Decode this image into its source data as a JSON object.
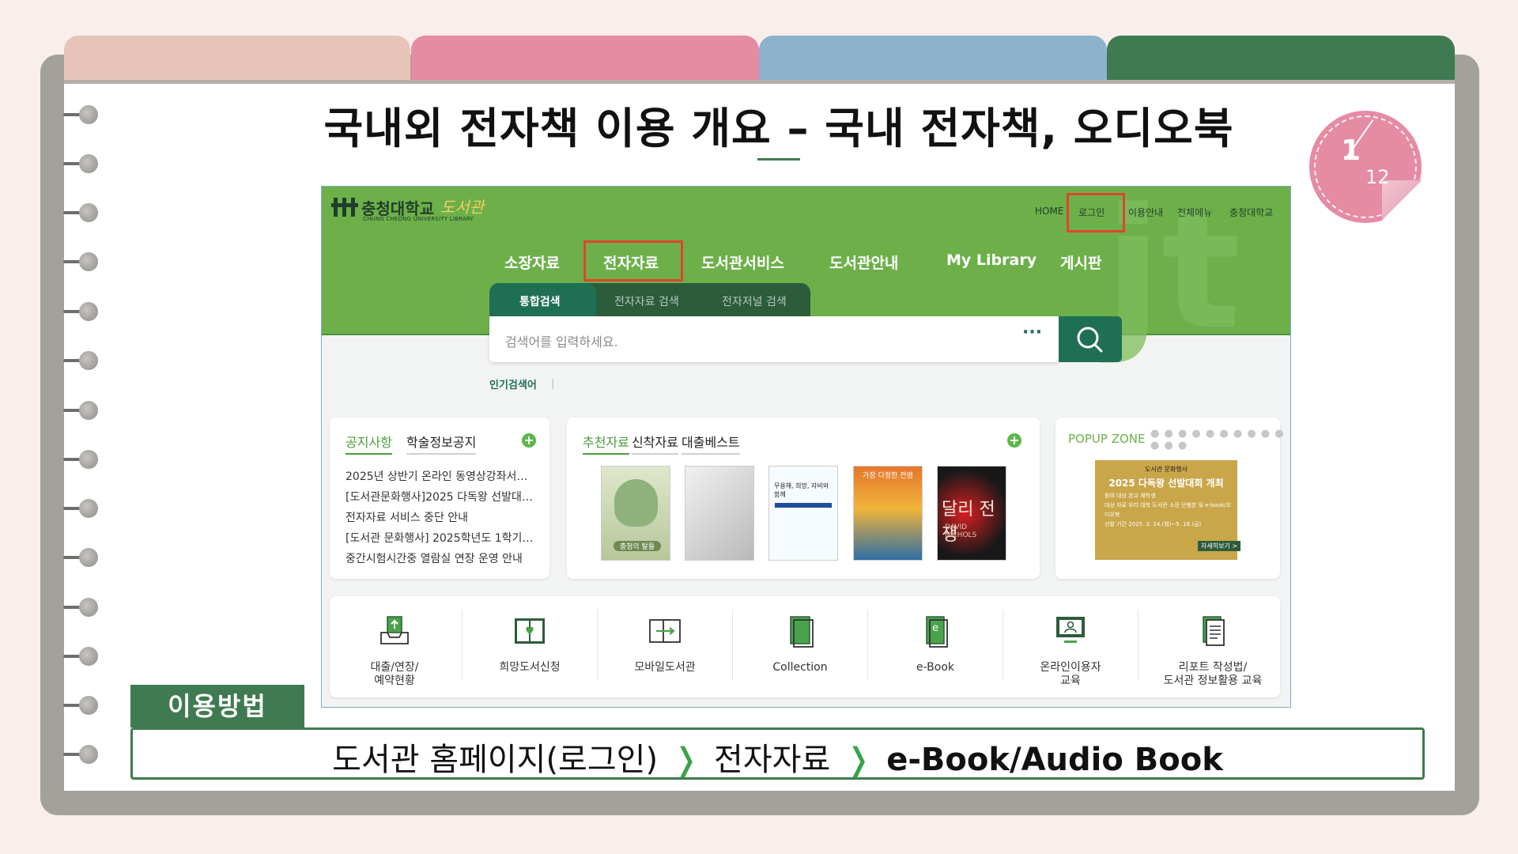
{
  "slide": {
    "title": "국내외 전자책 이용 개요 – 국내 전자책, 오디오북",
    "page_current": "1",
    "page_total": "12"
  },
  "site": {
    "logo_name": "충청대학교",
    "logo_library": "도서관",
    "logo_sub": "CHUNG CHEONG UNIVERSITY LIBRARY",
    "watermark": "jt",
    "top_nav": [
      "HOME",
      "로그인",
      "이용안내",
      "전체메뉴",
      "충청대학교"
    ],
    "main_nav": [
      "소장자료",
      "전자자료",
      "도서관서비스",
      "도서관안내",
      "My Library",
      "게시판"
    ],
    "search_tabs": [
      "통합검색",
      "전자자료 검색",
      "전자저널 검색"
    ],
    "search_placeholder": "검색어를 입력하세요.",
    "search_more": "···",
    "popular_label": "인기검색어",
    "popular_sep": "|",
    "notice_tabs": [
      "공지사항",
      "학술정보공지"
    ],
    "notices": [
      "2025년 상반기 온라인 동영상강좌서…",
      "[도서관문화행사]2025 다독왕 선발대…",
      "전자자료 서비스 중단 안내",
      "[도서관 문화행사] 2025학년도 1학기…",
      "중간시험시간중 열람실 연장 운영 안내"
    ],
    "book_tabs": [
      "추천자료",
      "신착자료",
      "대출베스트"
    ],
    "plus": "+",
    "books": {
      "b1_title": "충청의 탈들",
      "b3_title": "무용해, 희망, 자비와 함께",
      "b4_title": "가장 다정한 전염",
      "b5_title": "달리 전쟁",
      "b5_sub": "DAVID NICHOLS"
    },
    "popup_title": "POPUP ZONE",
    "popup_dots": "● ● ● ● ● ● ● ● ● ● ● ● ●",
    "poster": {
      "header": "도서관 문화행사",
      "title": "2025 다독왕 선발대회 개최",
      "line1": "참여 대상  본교 재학생",
      "line2": "대상 자료  우리 대학 도서관 소장 단행본 및 e-book/오디오북",
      "line3": "선발 기간  2025. 3. 24.(월)~5. 16.(금)",
      "button": "자세히보기 >"
    },
    "quick_links": [
      {
        "line1": "대출/연장/",
        "line2": "예약현황"
      },
      {
        "line1": "희망도서신청",
        "line2": ""
      },
      {
        "line1": "모바일도서관",
        "line2": ""
      },
      {
        "line1": "Collection",
        "line2": ""
      },
      {
        "line1": "e-Book",
        "line2": ""
      },
      {
        "line1": "온라인이용자",
        "line2": "교육"
      },
      {
        "line1": "리포트 작성법/",
        "line2": "도서관 정보활용 교육"
      }
    ]
  },
  "usage": {
    "label": "이용방법",
    "step1": "도서관 홈페이지(로그인)",
    "chevron": "❭",
    "step2": "전자자료",
    "step3": "e-Book/Audio Book"
  },
  "colors": {
    "site_green": "#6db04a",
    "dark_green": "#1f6f55",
    "highlight_red": "#e0442a",
    "binder_green": "#3f7a50",
    "badge_pink": "#e58ba3"
  }
}
